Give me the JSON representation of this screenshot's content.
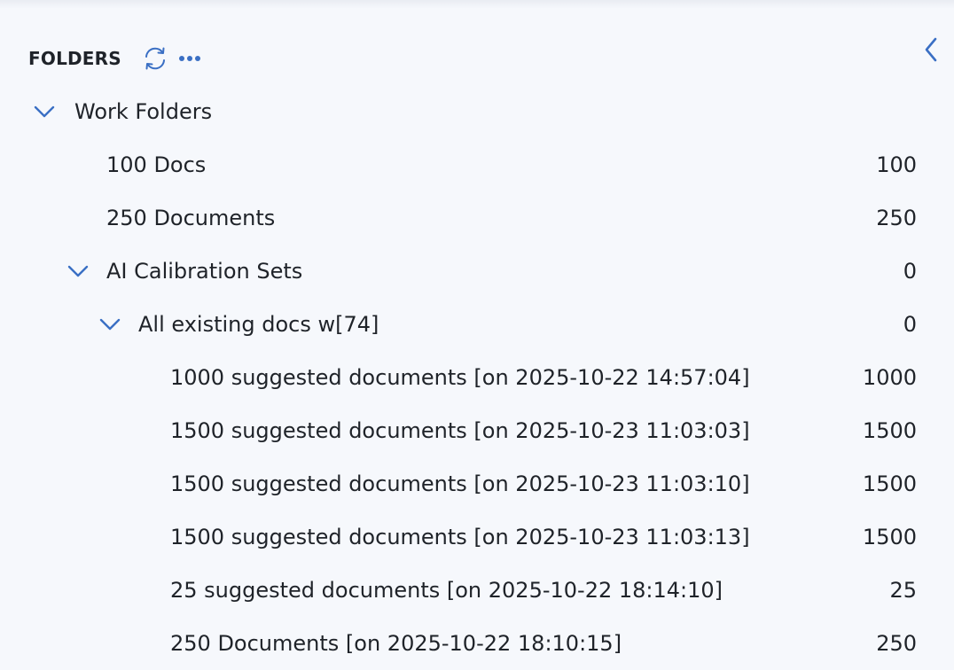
{
  "header": {
    "title": "FOLDERS",
    "refresh_icon": "refresh-icon",
    "more_icon": "more-horizontal-icon",
    "collapse_icon": "chevron-left-icon"
  },
  "colors": {
    "accent": "#3a6fc4",
    "background": "#f6f8fc",
    "text": "#1f2329"
  },
  "tree": {
    "root": {
      "label": "Work Folders",
      "expanded": true
    },
    "items": [
      {
        "label": "100 Docs",
        "count": "100"
      },
      {
        "label": "250 Documents",
        "count": "250"
      },
      {
        "label": "AI Calibration Sets",
        "count": "0",
        "expanded": true
      },
      {
        "label": "All existing docs w[74]",
        "count": "0",
        "expanded": true
      },
      {
        "label": "1000 suggested documents [on 2025-10-22 14:57:04]",
        "count": "1000"
      },
      {
        "label": "1500 suggested documents [on 2025-10-23 11:03:03]",
        "count": "1500"
      },
      {
        "label": "1500 suggested documents [on 2025-10-23 11:03:10]",
        "count": "1500"
      },
      {
        "label": "1500 suggested documents [on 2025-10-23 11:03:13]",
        "count": "1500"
      },
      {
        "label": "25 suggested documents [on 2025-10-22 18:14:10]",
        "count": "25"
      },
      {
        "label": "250 Documents [on 2025-10-22 18:10:15]",
        "count": "250"
      }
    ]
  }
}
